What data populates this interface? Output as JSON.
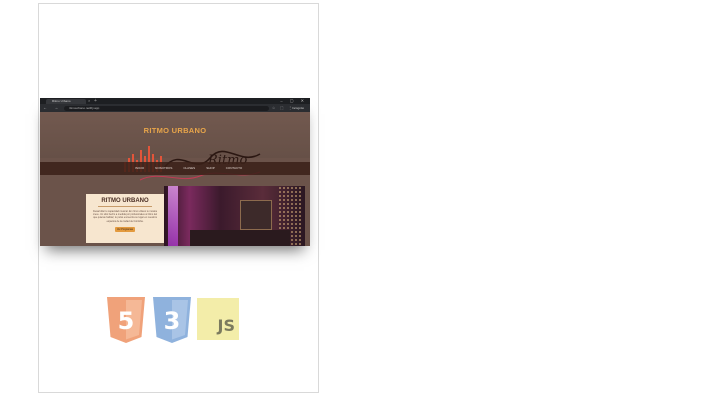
{
  "browser": {
    "tab_title": "Ritmo Urbano",
    "tab_close": "×",
    "tab_new": "+",
    "window_controls": "– ▢ ✕",
    "nav_buttons": "← → ⟳",
    "url": "ritmourbano.netlify.app",
    "toolbar_icons": "☆ ⬚ ⋮",
    "incognito_label": "Incógnito"
  },
  "site": {
    "brand_title": "RITMO URBANO",
    "logo_script": "Ritmo",
    "nav": [
      "INICIO",
      "NOSOTROS",
      "CLASES",
      "SHOP",
      "CONTACTO"
    ],
    "card": {
      "title": "RITMO URBANO",
      "text": "Desarrollar tu capacidad musical. En ritmo urbano tu música crece. Un sitio hecho a medida por profesionales al ritmo del que quieras habitar; tu pulso encuentra su lugar en nuestros espacios de la ciudad de Córdoba.",
      "button": "Ver Programas"
    }
  },
  "tech_logos": {
    "html_number": "5",
    "css_number": "3",
    "js_label": "JS"
  },
  "colors": {
    "brand_accent": "#e8a54a",
    "html5_orange": "#f0a27a",
    "css3_blue": "#8fb2dd",
    "js_yellow": "#f3eda9"
  }
}
